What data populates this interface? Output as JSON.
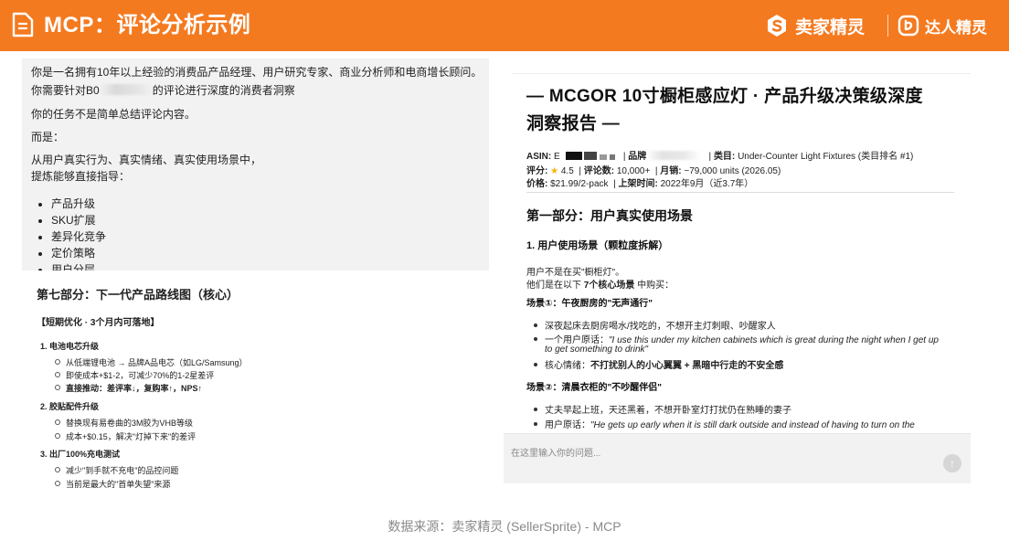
{
  "header": {
    "title": "MCP：评论分析示例",
    "brand_primary": "卖家精灵",
    "brand_secondary": "达人精灵",
    "accent_color": "#f47a20",
    "icons": [
      "document-icon",
      "sellersprite-logo-icon",
      "daren-logo-icon"
    ]
  },
  "prompt": {
    "line1": "你是一名拥有10年以上经验的消费品产品经理、用户研究专家、商业分析师和电商增长顾问。",
    "line2_prefix": "你需要针对B0",
    "line2_suffix": "的评论进行深度的消费者洞察",
    "line3": "你的任务不是简单总结评论内容。",
    "line4": "而是：",
    "line5": "从用户真实行为、真实情绪、真实使用场景中，",
    "line6": "提炼能够直接指导：",
    "bullets": [
      "产品升级",
      "SKU扩展",
      "差异化竞争",
      "定价策略",
      "用户分层"
    ]
  },
  "roadmap": {
    "heading": "第七部分：下一代产品路线图（核心）",
    "subheading": "【短期优化 · 3个月内可落地】",
    "items": [
      {
        "title": "1. 电池电芯升级",
        "points": [
          {
            "text": "从低端锂电池 → 品牌A品电芯（如LG/Samsung）"
          },
          {
            "text": "即使成本+$1-2，可减少70%的1-2星差评"
          },
          {
            "label": "直接推动：",
            "text": "差评率↓，复购率↑，NPS↑"
          }
        ]
      },
      {
        "title": "2. 胶贴配件升级",
        "points": [
          {
            "text": "替换现有易卷曲的3M胶为VHB等级"
          },
          {
            "text": "成本+$0.15，解决\"灯掉下来\"的差评"
          }
        ]
      },
      {
        "title": "3. 出厂100%充电测试",
        "points": [
          {
            "text": "减少\"到手就不充电\"的品控问题"
          },
          {
            "text": "当前是最大的\"首单失望\"来源"
          }
        ]
      }
    ]
  },
  "report": {
    "title_line1": "— MCGOR 10寸橱柜感应灯 · 产品升级决策级深度",
    "title_line2": "洞察报告 —",
    "meta": {
      "asin_label": "ASIN:",
      "asin_prefix": "E",
      "brand_label": "品牌",
      "category_label": "类目:",
      "category_value": "Under-Counter Light Fixtures (类目排名 #1)",
      "rating_label": "评分:",
      "rating_value": "4.5",
      "review_count_label": "评论数:",
      "review_count_value": "10,000+",
      "monthly_sales_label": "月销:",
      "monthly_sales_value": "~79,000 units (2026.05)",
      "price_label": "价格:",
      "price_value": "$21.99/2-pack",
      "launch_label": "上架时间:",
      "launch_value": "2022年9月（近3.7年）",
      "sep": "|"
    },
    "part1_title": "第一部分：用户真实使用场景",
    "section1_title": "1. 用户使用场景（颗粒度拆解）",
    "intro_line1": "用户不是在买\"橱柜灯\"。",
    "intro_prefix": "他们是在以下",
    "intro_bold": "7个核心场景",
    "intro_suffix": "中购买：",
    "scenario1_title": "场景①：午夜厨房的\"无声通行\"",
    "scenario1_points": {
      "p1": "深夜起床去厨房喝水/找吃的，不想开主灯刺眼、吵醒家人",
      "p2_label": "一个用户原话：",
      "p2_quote_line1": "\"I use this under my kitchen cabinets which is great during the night when I get up",
      "p2_quote_line2": "to get something to drink\"",
      "p3_label": "核心情绪：",
      "p3_text": "不打扰别人的小心翼翼 + 黑暗中行走的不安全感"
    },
    "scenario2_title": "场景②：清晨衣柜的\"不吵醒伴侣\"",
    "scenario2_points": {
      "p1": "丈夫早起上班，天还黑着，不想开卧室灯打扰仍在熟睡的妻子",
      "p2_label": "用户原话：",
      "p2_quote_line1": "\"He gets up early when it is still dark outside and instead of having to turn on the"
    }
  },
  "chat": {
    "placeholder": "在这里输入你的问题...",
    "send_icon": "arrow-up-icon",
    "send_symbol": "↑"
  },
  "footer": {
    "source": "数据来源：卖家精灵 (SellerSprite) - MCP"
  }
}
